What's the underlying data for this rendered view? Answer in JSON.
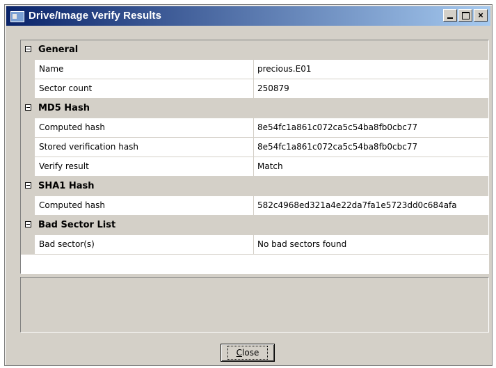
{
  "window": {
    "title": "Drive/Image Verify Results",
    "buttons": {
      "minimize": "_",
      "maximize": "□",
      "close": "×"
    }
  },
  "sections": [
    {
      "label": "General",
      "rows": [
        {
          "name": "Name",
          "value": "precious.E01"
        },
        {
          "name": "Sector count",
          "value": "250879"
        }
      ]
    },
    {
      "label": "MD5 Hash",
      "rows": [
        {
          "name": "Computed hash",
          "value": "8e54fc1a861c072ca5c54ba8fb0cbc77"
        },
        {
          "name": "Stored verification hash",
          "value": "8e54fc1a861c072ca5c54ba8fb0cbc77"
        },
        {
          "name": "Verify result",
          "value": "Match"
        }
      ]
    },
    {
      "label": "SHA1 Hash",
      "rows": [
        {
          "name": "Computed hash",
          "value": "582c4968ed321a4e22da7fa1e5723dd0c684afa"
        }
      ]
    },
    {
      "label": "Bad Sector List",
      "rows": [
        {
          "name": "Bad sector(s)",
          "value": "No bad sectors found"
        }
      ]
    }
  ],
  "close_button": {
    "label_accel": "C",
    "label_rest": "lose"
  },
  "colors": {
    "titlebar_start": "#0a246a",
    "titlebar_end": "#a6caf0",
    "face": "#d4d0c8"
  }
}
